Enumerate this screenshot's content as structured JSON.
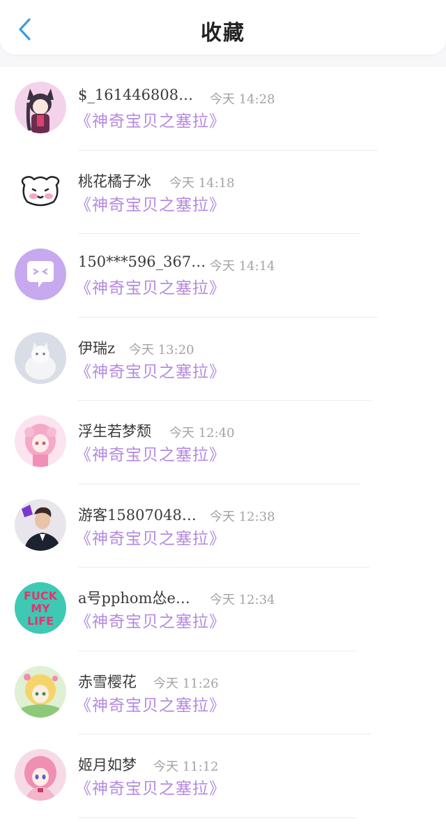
{
  "header": {
    "title": "收藏",
    "back_icon": "chevron-left-icon",
    "accent": "#3a9be8"
  },
  "topic_color": "#b48ae0",
  "items": [
    {
      "name": "$_161446808…",
      "time": "今天 14:28",
      "topic": "《神奇宝贝之塞拉》",
      "avatar": "anime-catgirl-avatar"
    },
    {
      "name": "桃花橘子冰",
      "time": "今天 14:18",
      "topic": "《神奇宝贝之塞拉》",
      "avatar": "cute-doodle-face-avatar"
    },
    {
      "name": "150***596_367…",
      "time": "今天 14:14",
      "topic": "《神奇宝贝之塞拉》",
      "avatar": "chat-bubble-avatar"
    },
    {
      "name": "伊瑞z",
      "time": "今天 13:20",
      "topic": "《神奇宝贝之塞拉》",
      "avatar": "white-cat-avatar"
    },
    {
      "name": "浮生若梦颓",
      "time": "今天 12:40",
      "topic": "《神奇宝贝之塞拉》",
      "avatar": "pink-anime-girl-avatar"
    },
    {
      "name": "游客15807048…",
      "time": "今天 12:38",
      "topic": "《神奇宝贝之塞拉》",
      "avatar": "man-portrait-avatar"
    },
    {
      "name": "a号pphom怂e…",
      "time": "今天 12:34",
      "topic": "《神奇宝贝之塞拉》",
      "avatar": "text-badge-avatar",
      "avatar_text": [
        "FUCK",
        "MY",
        "LIFE"
      ]
    },
    {
      "name": "赤雪樱花",
      "time": "今天 11:26",
      "topic": "《神奇宝贝之塞拉》",
      "avatar": "blonde-anime-girl-avatar"
    },
    {
      "name": "姬月如梦",
      "time": "今天 11:12",
      "topic": "《神奇宝贝之塞拉》",
      "avatar": "pink-hair-anime-avatar"
    }
  ]
}
